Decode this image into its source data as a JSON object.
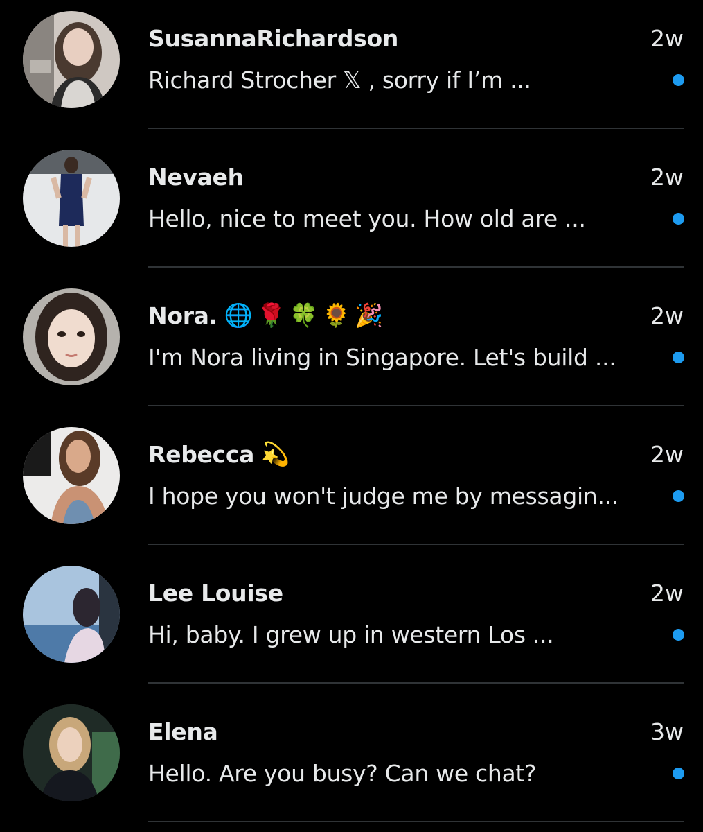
{
  "colors": {
    "background": "#000000",
    "text": "#e7e9ea",
    "unread_dot": "#1d9bf0",
    "divider": "#2f3336"
  },
  "conversations": [
    {
      "name": "SusannaRichardson",
      "emojis": "",
      "time": "2w",
      "preview": "Richard Strocher 𝕏 , sorry if I’m ...",
      "unread": true,
      "avatar": "avatar-photo"
    },
    {
      "name": "Nevaeh",
      "emojis": "",
      "time": "2w",
      "preview": "Hello, nice to meet you. How old are ...",
      "unread": true,
      "avatar": "avatar-photo"
    },
    {
      "name": "Nora.",
      "emojis": "🌐🌹🍀🌻🎉",
      "time": "2w",
      "preview": "I'm Nora living in Singapore. Let's build ...",
      "unread": true,
      "avatar": "avatar-photo"
    },
    {
      "name": "Rebecca",
      "emojis": "💫",
      "time": "2w",
      "preview": "I hope you won't judge me by messagin...",
      "unread": true,
      "avatar": "avatar-photo"
    },
    {
      "name": "Lee Louise",
      "emojis": "",
      "time": "2w",
      "preview": "Hi, baby. I grew up in western Los ...",
      "unread": true,
      "avatar": "avatar-photo"
    },
    {
      "name": "Elena",
      "emojis": "",
      "time": "3w",
      "preview": "Hello. Are you busy? Can we chat?",
      "unread": true,
      "avatar": "avatar-photo"
    }
  ]
}
